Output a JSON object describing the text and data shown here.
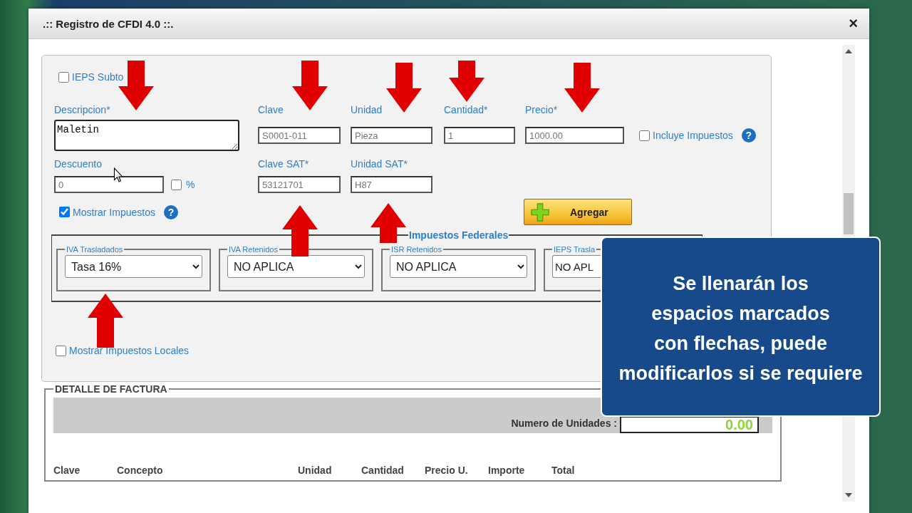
{
  "window": {
    "title": ".:: Registro de CFDI 4.0 ::.",
    "close": "×"
  },
  "form": {
    "ieps_subtotal": {
      "label": "IEPS Subto",
      "checked": false
    },
    "descripcion": {
      "label": "Descripcion*",
      "value": "Maletin"
    },
    "clave": {
      "label": "Clave",
      "value": "S0001-011"
    },
    "unidad": {
      "label": "Unidad",
      "value": "Pieza"
    },
    "cantidad": {
      "label": "Cantidad*",
      "value": "1"
    },
    "precio": {
      "label": "Precio*",
      "value": "1000.00"
    },
    "incluye_impuestos": {
      "label": "Incluye Impuestos",
      "checked": false,
      "help": "?"
    },
    "descuento": {
      "label": "Descuento",
      "value": "0"
    },
    "descuento_percent": {
      "label": "%",
      "checked": false
    },
    "clave_sat": {
      "label": "Clave SAT*",
      "value": "53121701"
    },
    "unidad_sat": {
      "label": "Unidad SAT*",
      "value": "H87"
    },
    "mostrar_impuestos": {
      "label": "Mostrar Impuestos",
      "checked": true,
      "help": "?"
    },
    "add_button": {
      "label": "Agregar"
    },
    "federal_taxes": {
      "title": "Impuestos Federales",
      "groups": [
        {
          "label": "IVA Trasladados",
          "value": "Tasa 16%"
        },
        {
          "label": "IVA Retenidos",
          "value": "NO APLICA"
        },
        {
          "label": "ISR Retenidos",
          "value": "NO APLICA"
        },
        {
          "label": "IEPS Trasla",
          "value": "NO APL"
        }
      ]
    },
    "mostrar_impuestos_locales": {
      "label": "Mostrar Impuestos Locales",
      "checked": false
    }
  },
  "invoice_detail": {
    "title": "DETALLE DE FACTURA",
    "units_label": "Numero de Unidades :",
    "units_value": "0.00",
    "columns": [
      "Clave",
      "Concepto",
      "Unidad",
      "Cantidad",
      "Precio U.",
      "Importe",
      "Total"
    ]
  },
  "annotations": {
    "callout": "Se llenarán los\nespacios marcados\ncon flechas, puede\nmodificarlos si se requiere",
    "arrows": [
      {
        "kind": "down"
      },
      {
        "kind": "down"
      },
      {
        "kind": "down"
      },
      {
        "kind": "down"
      },
      {
        "kind": "down"
      },
      {
        "kind": "up"
      },
      {
        "kind": "up"
      },
      {
        "kind": "up"
      }
    ]
  }
}
